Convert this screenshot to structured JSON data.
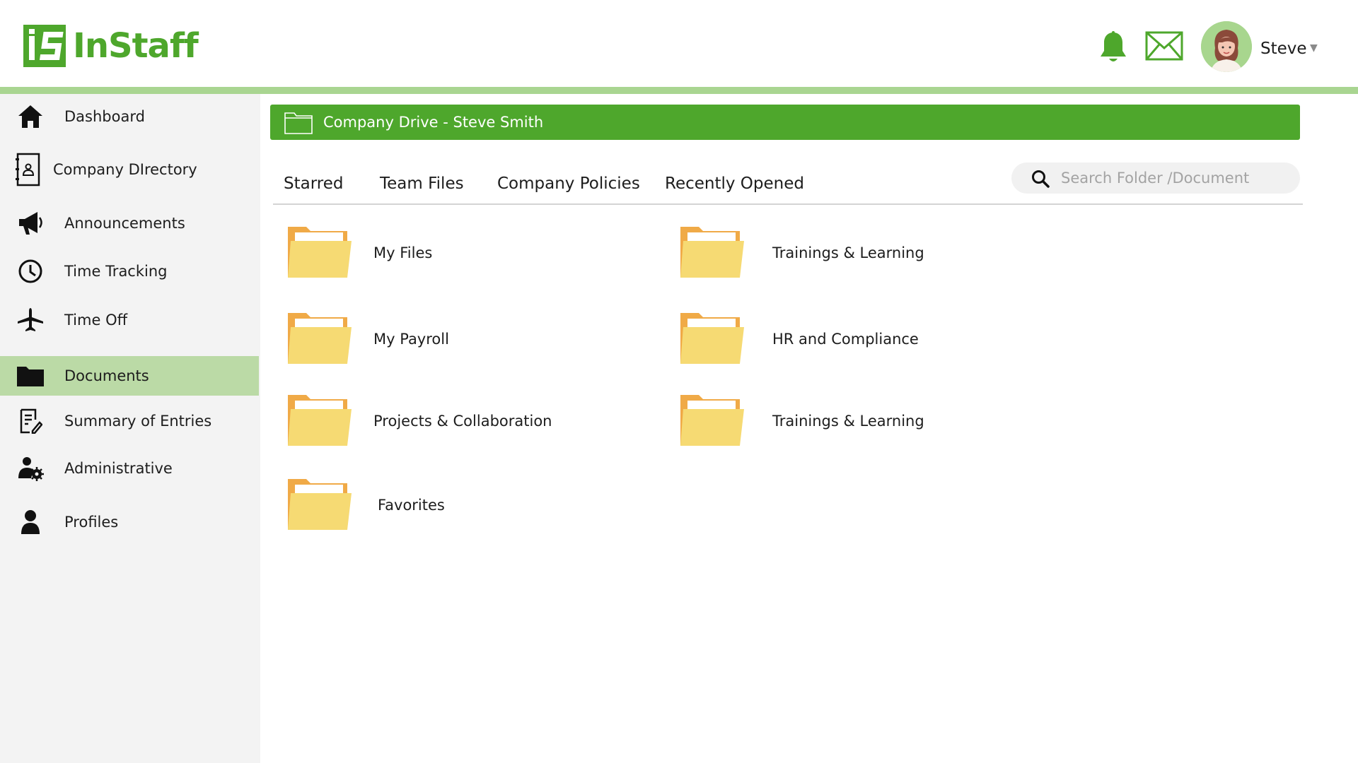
{
  "app": {
    "brand": "InStaff",
    "user_name": "Steve"
  },
  "colors": {
    "brand_green": "#4ea72c",
    "accent_bar": "#a9d591",
    "active_nav": "#bbdaa6",
    "folder_yellow": "#f6da73",
    "folder_orange": "#f0aa47"
  },
  "sidebar": {
    "items": [
      {
        "label": "Dashboard",
        "icon": "home-icon"
      },
      {
        "label": "Company DIrectory",
        "icon": "contact-book-icon"
      },
      {
        "label": "Announcements",
        "icon": "megaphone-icon"
      },
      {
        "label": "Time Tracking",
        "icon": "clock-icon"
      },
      {
        "label": "Time Off",
        "icon": "airplane-icon"
      },
      {
        "label": "Documents",
        "icon": "folder-icon",
        "active": true
      },
      {
        "label": "Summary of Entries",
        "icon": "document-edit-icon"
      },
      {
        "label": "Administrative",
        "icon": "user-gear-icon"
      },
      {
        "label": "Profiles",
        "icon": "user-icon"
      }
    ]
  },
  "main": {
    "drive_title": "Company Drive - Steve Smith",
    "tabs": [
      {
        "label": "Starred"
      },
      {
        "label": "Team Files"
      },
      {
        "label": "Company Policies"
      },
      {
        "label": "Recently Opened"
      }
    ],
    "search": {
      "placeholder": "Search Folder /Document"
    },
    "folders": [
      {
        "label": "My Files"
      },
      {
        "label": "Trainings & Learning"
      },
      {
        "label": "My Payroll"
      },
      {
        "label": "HR and Compliance"
      },
      {
        "label": "Projects & Collaboration"
      },
      {
        "label": "Trainings & Learning"
      },
      {
        "label": "Favorites"
      }
    ]
  }
}
